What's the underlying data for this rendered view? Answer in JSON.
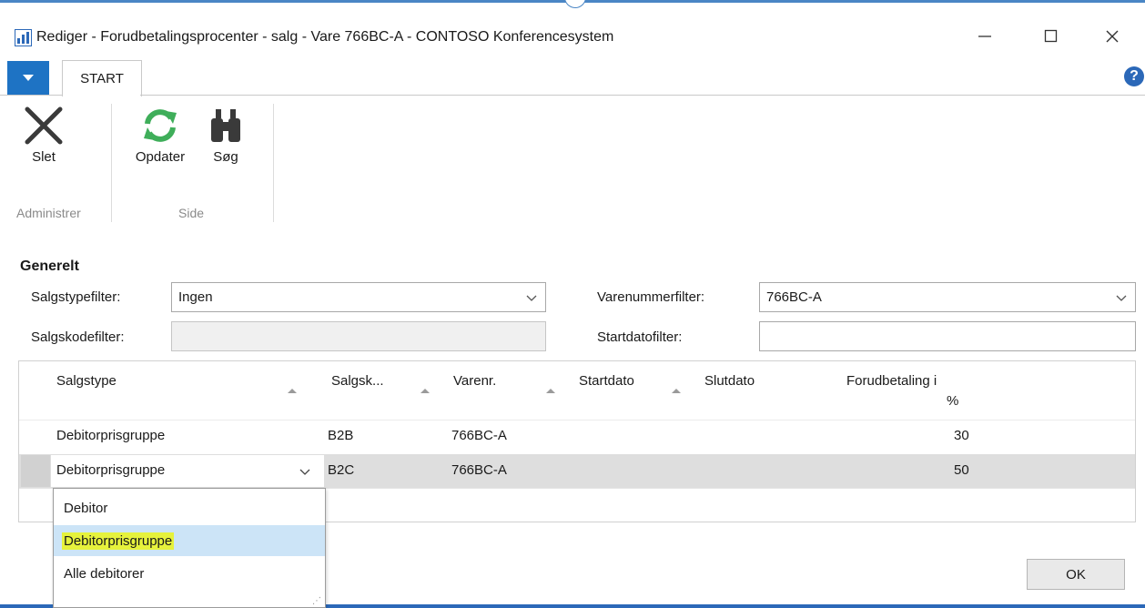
{
  "window": {
    "title": "Rediger - Forudbetalingsprocenter - salg - Vare 766BC-A - CONTOSO Konferencesystem",
    "minimize_glyph": "—",
    "maximize_glyph": "☐",
    "close_glyph": "✕"
  },
  "ribbon": {
    "tab": "START",
    "help_glyph": "?",
    "buttons": {
      "delete": "Slet",
      "refresh": "Opdater",
      "find": "Søg"
    },
    "groups": {
      "manage": "Administrer",
      "page": "Side"
    },
    "icons": {
      "delete": "x-icon",
      "refresh": "refresh-icon",
      "find": "binoculars-icon"
    },
    "colors": {
      "accent": "#1e73c4",
      "refresh": "#3fae5a"
    }
  },
  "general": {
    "title": "Generelt",
    "sales_type_filter": {
      "label": "Salgstypefilter:",
      "value": "Ingen"
    },
    "sales_code_filter": {
      "label": "Salgskodefilter:",
      "value": ""
    },
    "item_no_filter": {
      "label": "Varenummerfilter:",
      "value": "766BC-A"
    },
    "start_date_filter": {
      "label": "Startdatofilter:",
      "value": ""
    }
  },
  "table": {
    "columns": {
      "sales_type": "Salgstype",
      "sales_code": "Salgsk...",
      "item_no": "Varenr.",
      "start_date": "Startdato",
      "end_date": "Slutdato",
      "prepayment": "Forudbetaling i",
      "prepayment_unit": "%"
    },
    "rows": [
      {
        "sales_type": "Debitorprisgruppe",
        "sales_code": "B2B",
        "item_no": "766BC-A",
        "prepayment": "30"
      },
      {
        "sales_type": "Debitorprisgruppe",
        "sales_code": "B2C",
        "item_no": "766BC-A",
        "prepayment": "50"
      }
    ]
  },
  "dropdown": {
    "options": [
      "Debitor",
      "Debitorprisgruppe",
      "Alle debitorer"
    ],
    "selected_index": 1
  },
  "footer": {
    "ok": "OK"
  }
}
